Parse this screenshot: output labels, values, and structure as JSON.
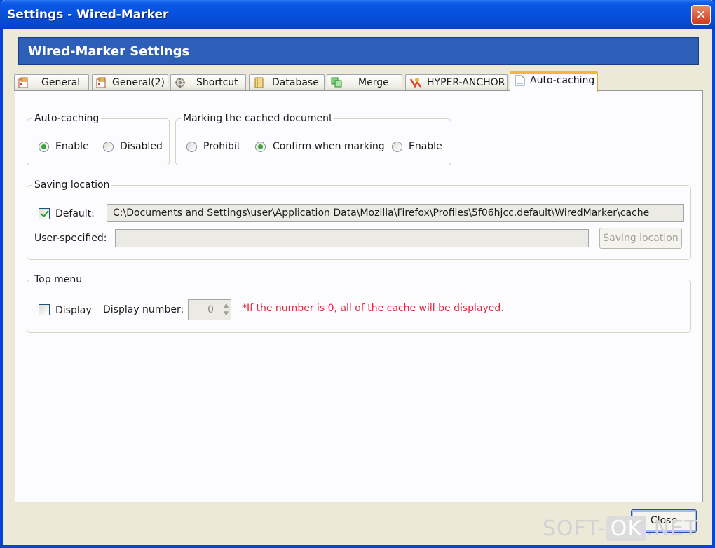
{
  "window": {
    "title": "Settings - Wired-Marker",
    "close_glyph": "✕"
  },
  "banner": {
    "title": "Wired-Marker Settings"
  },
  "tabs": [
    {
      "label": "General",
      "icon": "general-icon",
      "active": false
    },
    {
      "label": "General(2)",
      "icon": "general-icon",
      "active": false
    },
    {
      "label": "Shortcut",
      "icon": "shortcut-icon",
      "active": false
    },
    {
      "label": "Database",
      "icon": "database-icon",
      "active": false
    },
    {
      "label": "Merge",
      "icon": "merge-icon",
      "active": false
    },
    {
      "label": "HYPER-ANCHOR",
      "icon": "hyper-anchor-icon",
      "active": false
    },
    {
      "label": "Auto-caching",
      "icon": "document-icon",
      "active": true
    }
  ],
  "auto_caching": {
    "legend": "Auto-caching",
    "options": [
      {
        "label": "Enable",
        "selected": true
      },
      {
        "label": "Disabled",
        "selected": false
      }
    ]
  },
  "marking": {
    "legend": "Marking the cached document",
    "options": [
      {
        "label": "Prohibit",
        "selected": false
      },
      {
        "label": "Confirm when marking",
        "selected": true
      },
      {
        "label": "Enable",
        "selected": false
      }
    ]
  },
  "saving": {
    "legend": "Saving location",
    "default_label": "Default:",
    "default_checked": true,
    "default_path": "C:\\Documents and Settings\\user\\Application Data\\Mozilla\\Firefox\\Profiles\\5f06hjcc.default\\WiredMarker\\cache",
    "user_label": "User-specified:",
    "user_value": "",
    "button_label": "Saving location"
  },
  "top_menu": {
    "legend": "Top menu",
    "display_label": "Display",
    "display_checked": false,
    "number_label": "Display number:",
    "number_value": "0",
    "note": "*If the number is 0, all of the cache will be displayed."
  },
  "footer": {
    "close_label": "Close"
  },
  "watermark": {
    "pre": "SOFT-",
    "ok": "OK",
    "post": ".NET"
  },
  "colors": {
    "title_bar": "#0651dc",
    "banner": "#2e5fb8",
    "note": "#e0283c",
    "active_tab_accent": "#f1b83c"
  }
}
